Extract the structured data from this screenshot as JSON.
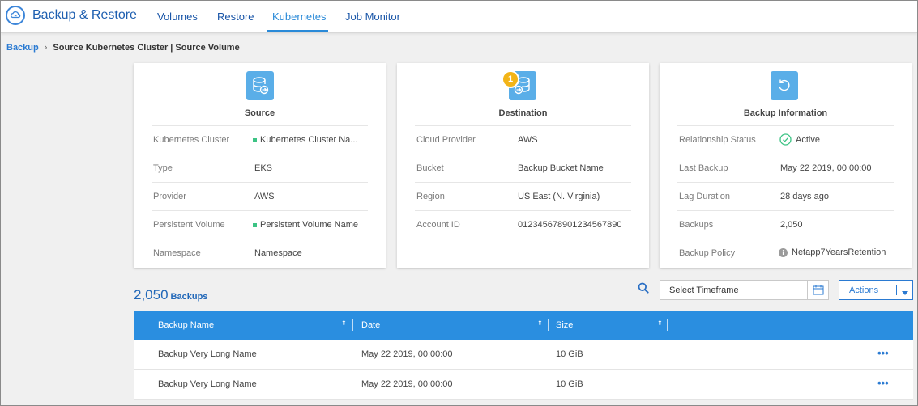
{
  "app": {
    "title": "Backup & Restore",
    "brand_color": "#1e5fb0"
  },
  "nav": {
    "tabs": [
      {
        "label": "Volumes"
      },
      {
        "label": "Restore"
      },
      {
        "label": "Kubernetes"
      },
      {
        "label": "Job Monitor"
      }
    ],
    "active_tab": "Kubernetes"
  },
  "breadcrumb": {
    "root": "Backup",
    "current": "Source Kubernetes Cluster | Source Volume"
  },
  "source_card": {
    "title": "Source",
    "icon": "database-arrow-icon",
    "rows": [
      {
        "label": "Kubernetes Cluster",
        "value": "Kubernetes Cluster Na..."
      },
      {
        "label": "Type",
        "value": "EKS"
      },
      {
        "label": "Provider",
        "value": "AWS"
      },
      {
        "label": "Persistent Volume",
        "value": "Persistent Volume Name"
      },
      {
        "label": "Namespace",
        "value": "Namespace"
      }
    ]
  },
  "destination_card": {
    "title": "Destination",
    "icon": "database-arrow-icon",
    "badge": "1",
    "rows": [
      {
        "label": "Cloud Provider",
        "value": "AWS"
      },
      {
        "label": "Bucket",
        "value": "Backup Bucket Name"
      },
      {
        "label": "Region",
        "value": "US East (N. Virginia)"
      },
      {
        "label": "Account ID",
        "value": "012345678901234567890"
      }
    ]
  },
  "info_card": {
    "title": "Backup Information",
    "icon": "restore-icon",
    "rows": [
      {
        "label": "Relationship Status",
        "value": "Active"
      },
      {
        "label": "Last Backup",
        "value": "May 22 2019, 00:00:00"
      },
      {
        "label": "Lag Duration",
        "value": "28 days ago"
      },
      {
        "label": "Backups",
        "value": "2,050"
      },
      {
        "label": "Backup Policy",
        "value": "Netapp7YearsRetention"
      }
    ]
  },
  "backups": {
    "count": "2,050",
    "word": "Backups",
    "timeframe_placeholder": "Select Timeframe",
    "actions_label": "Actions"
  },
  "table": {
    "columns": [
      "Backup Name",
      "Date",
      "Size"
    ],
    "rows": [
      {
        "name": "Backup Very Long Name",
        "date": "May 22 2019, 00:00:00",
        "size": "10 GiB",
        "more": "•••"
      },
      {
        "name": "Backup Very Long Name",
        "date": "May 22 2019, 00:00:00",
        "size": "10 GiB",
        "more": "•••"
      }
    ]
  },
  "colors": {
    "accent": "#2a8ee0",
    "link": "#2a7ad2",
    "status_green": "#3cc384",
    "badge_yellow": "#f2b418"
  }
}
